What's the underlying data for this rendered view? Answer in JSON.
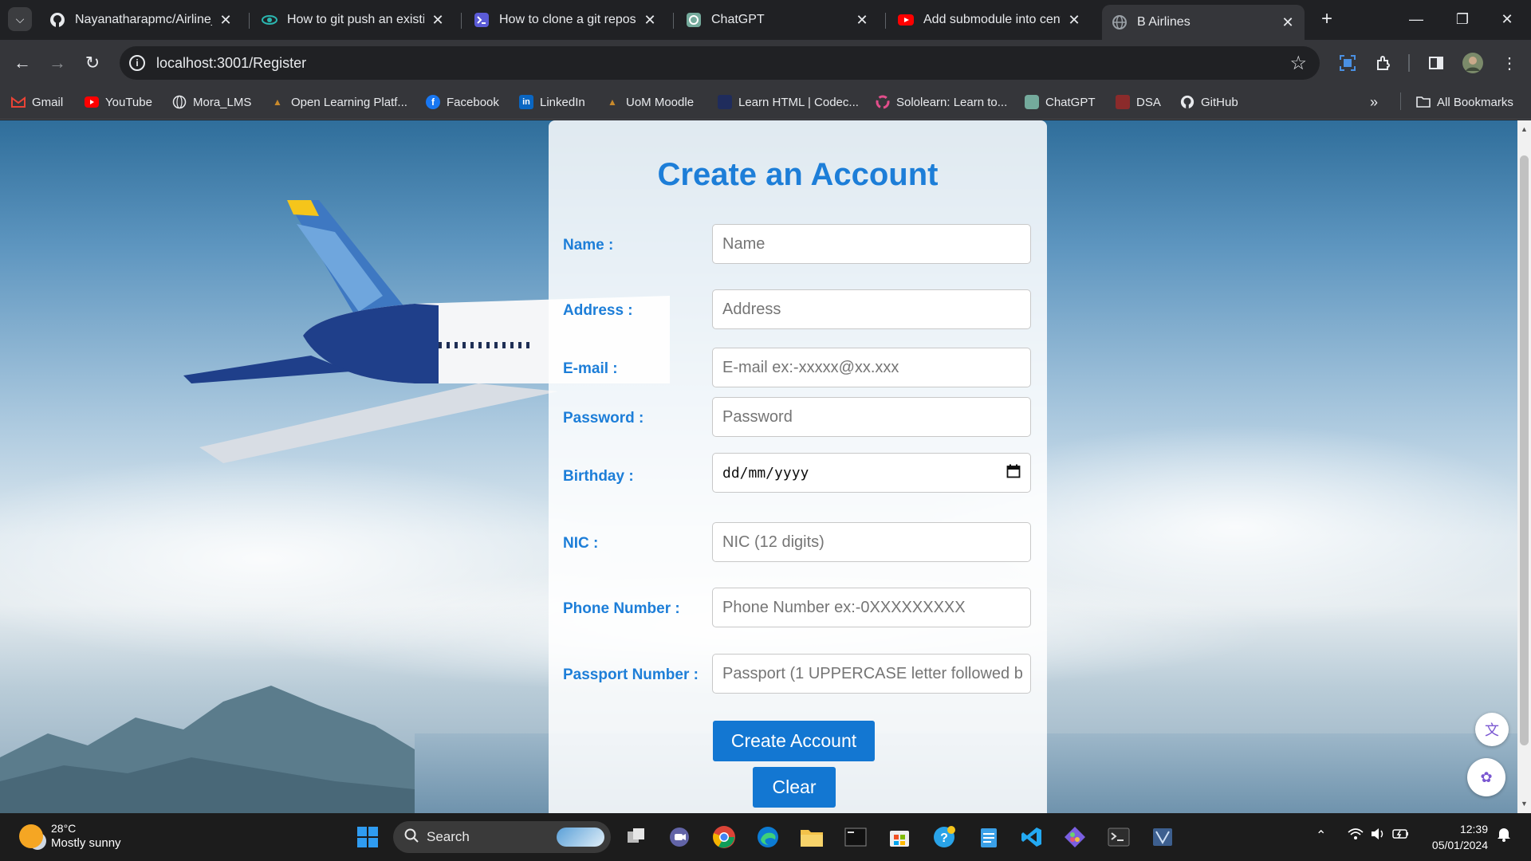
{
  "browser": {
    "tabs": [
      {
        "title": "Nayanatharapmc/Airline_R",
        "icon": "github-icon",
        "active": false
      },
      {
        "title": "How to git push an existing",
        "icon": "eye-icon",
        "active": false
      },
      {
        "title": "How to clone a git reposito",
        "icon": "terminal-icon",
        "active": false
      },
      {
        "title": "ChatGPT",
        "icon": "chatgpt-icon",
        "active": false
      },
      {
        "title": "Add submodule into centr",
        "icon": "youtube-icon",
        "active": false
      },
      {
        "title": "B Airlines",
        "icon": "globe-icon",
        "active": true
      }
    ],
    "url": "localhost:3001/Register",
    "bookmarks": [
      {
        "label": "Gmail",
        "icon": "gmail-icon",
        "color": "#ea4335"
      },
      {
        "label": "YouTube",
        "icon": "youtube-icon",
        "color": "#ff0000"
      },
      {
        "label": "Mora_LMS",
        "icon": "globe-icon",
        "color": "#9aa0a6"
      },
      {
        "label": "Open Learning Platf...",
        "icon": "flame-icon",
        "color": "#c98a2b"
      },
      {
        "label": "Facebook",
        "icon": "facebook-icon",
        "color": "#1877f2"
      },
      {
        "label": "LinkedIn",
        "icon": "linkedin-icon",
        "color": "#0a66c2"
      },
      {
        "label": "UoM Moodle",
        "icon": "flame-icon",
        "color": "#c98a2b"
      },
      {
        "label": "Learn HTML | Codec...",
        "icon": "codecademy-icon",
        "color": "#1f2c5c"
      },
      {
        "label": "Sololearn: Learn to...",
        "icon": "sololearn-icon",
        "color": "#e24e8b"
      },
      {
        "label": "ChatGPT",
        "icon": "chatgpt-icon",
        "color": "#74aa9c"
      },
      {
        "label": "DSA",
        "icon": "dsa-icon",
        "color": "#8b2b2b"
      },
      {
        "label": "GitHub",
        "icon": "github-icon",
        "color": "#ffffff"
      }
    ],
    "all_bookmarks_label": "All Bookmarks"
  },
  "form": {
    "title": "Create an Account",
    "fields": [
      {
        "label": "Name :",
        "placeholder": "Name"
      },
      {
        "label": "Address :",
        "placeholder": "Address"
      },
      {
        "label": "E-mail :",
        "placeholder": "E-mail ex:-xxxxx@xx.xxx"
      },
      {
        "label": "Password :",
        "placeholder": "Password"
      },
      {
        "label": "Birthday :",
        "placeholder": "dd/mm/yyyy"
      },
      {
        "label": "NIC :",
        "placeholder": "NIC (12 digits)"
      },
      {
        "label": "Phone Number :",
        "placeholder": "Phone Number ex:-0XXXXXXXXX"
      },
      {
        "label": "Passport Number :",
        "placeholder": "Passport (1 UPPERCASE letter followed b"
      }
    ],
    "create_button": "Create Account",
    "clear_button": "Clear",
    "accent_color": "#1d7ed8",
    "button_color": "#1377d2"
  },
  "taskbar": {
    "weather_temp": "28°C",
    "weather_condition": "Mostly sunny",
    "search_label": "Search",
    "time": "12:39",
    "date": "05/01/2024"
  }
}
